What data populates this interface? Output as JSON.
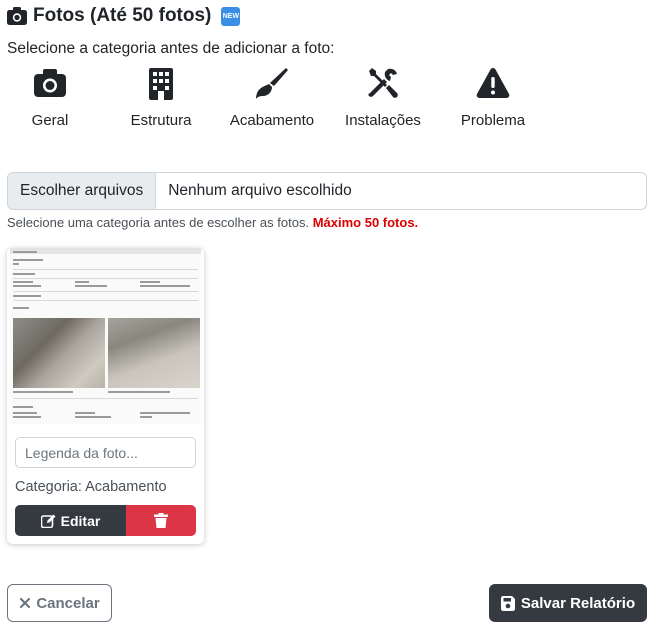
{
  "header": {
    "title": "Fotos (Até 50 fotos)",
    "badge": "NEW",
    "instruction": "Selecione a categoria antes de adicionar a foto:"
  },
  "categories": [
    {
      "label": "Geral",
      "icon": "camera-icon"
    },
    {
      "label": "Estrutura",
      "icon": "building-icon"
    },
    {
      "label": "Acabamento",
      "icon": "paintbrush-icon"
    },
    {
      "label": "Instalações",
      "icon": "tools-icon"
    },
    {
      "label": "Problema",
      "icon": "warning-icon"
    }
  ],
  "file_input": {
    "button_label": "Escolher arquivos",
    "status": "Nenhum arquivo escolhido"
  },
  "help": {
    "text": "Selecione uma categoria antes de escolher as fotos.",
    "max": "Máximo 50 fotos."
  },
  "photo_card": {
    "caption_placeholder": "Legenda da foto...",
    "category_text": "Categoria: Acabamento",
    "edit_label": "Editar"
  },
  "footer": {
    "cancel_label": "Cancelar",
    "save_label": "Salvar Relatório"
  },
  "colors": {
    "dark": "#343a40",
    "danger": "#dc3545",
    "max_text": "#dc0000",
    "badge": "#3a8ee6"
  }
}
